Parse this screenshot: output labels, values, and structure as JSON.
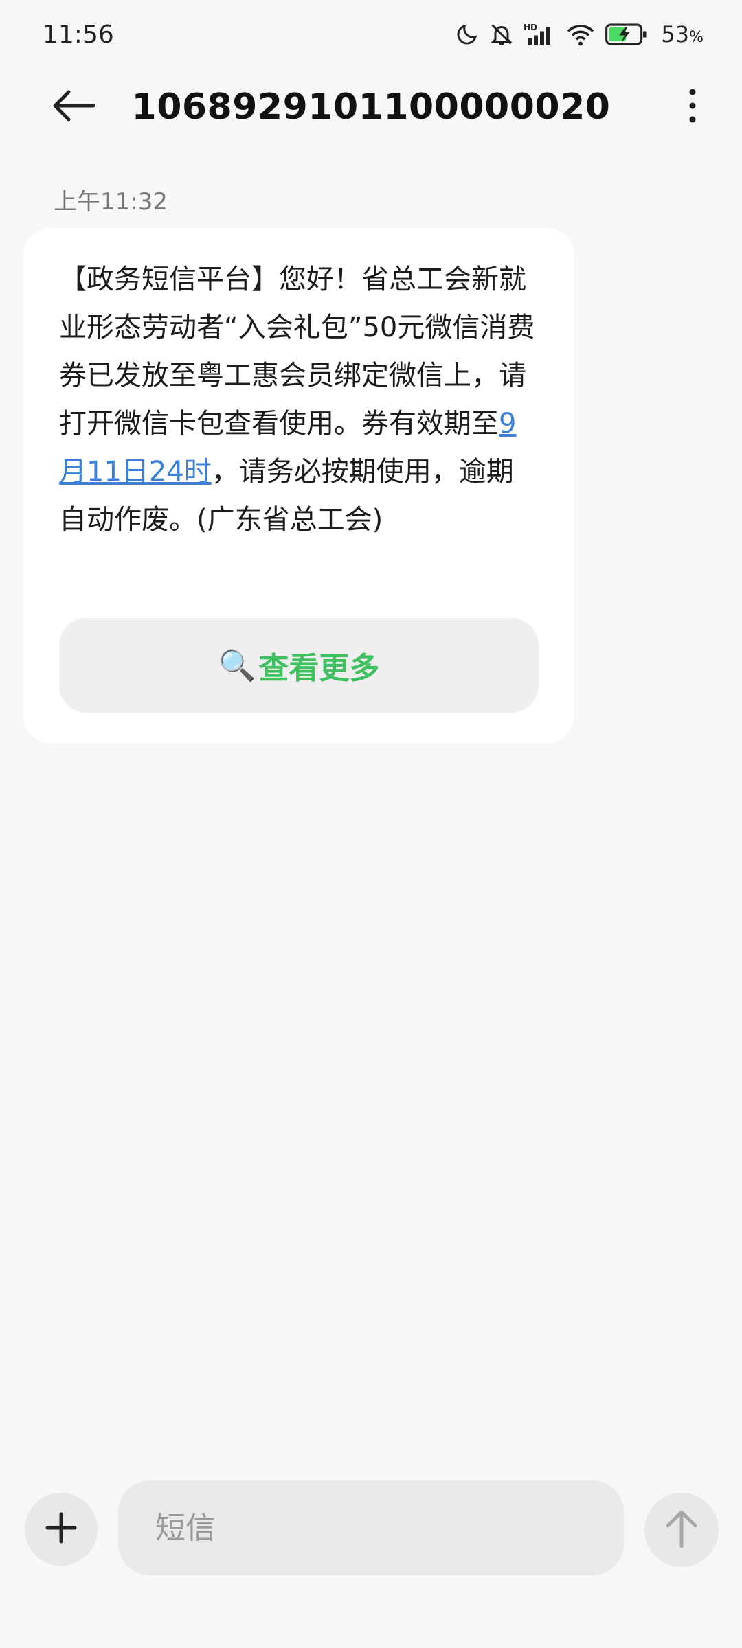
{
  "status_bar": {
    "time": "11:56",
    "battery_percent": "53",
    "battery_unit": "%",
    "icons": [
      "moon-icon",
      "bell-off-icon",
      "hd-signal-icon",
      "wifi-icon",
      "battery-charging-icon"
    ],
    "hd_label": "HD"
  },
  "header": {
    "title": "1068929101100000020",
    "back_icon": "arrow-left-icon",
    "more_icon": "more-vertical-icon"
  },
  "conversation": {
    "timestamp": "上午11:32",
    "message": {
      "text_before_link": "【政务短信平台】您好！省总工会新就业形态劳动者“入会礼包”50元微信消费券已发放至粤工惠会员绑定微信上，请打开微信卡包查看使用。券有效期至",
      "link_text": "9月11日24时",
      "text_after_link": "，请务必按期使用，逾期自动作废。(广东省总工会)",
      "action_icon": "🔍",
      "action_label": "查看更多"
    }
  },
  "input_bar": {
    "placeholder": "短信",
    "plus_icon": "plus-icon",
    "send_icon": "arrow-up-icon"
  },
  "colors": {
    "background": "#f7f7f7",
    "bubble": "#ffffff",
    "link": "#3b7fd6",
    "action_label": "#3fbf5f",
    "battery_fill": "#4cd964"
  }
}
